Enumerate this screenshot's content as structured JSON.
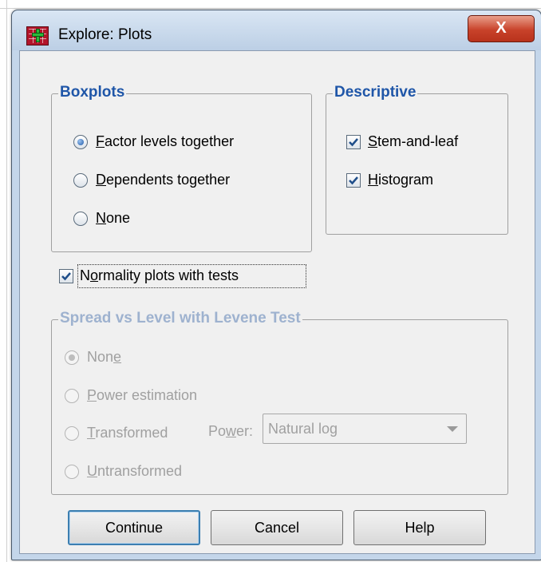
{
  "window": {
    "title": "Explore: Plots",
    "close_glyph": "X",
    "icon": "spss-app-icon"
  },
  "boxplots": {
    "legend": "Boxplots",
    "options": [
      {
        "pre": "",
        "key": "F",
        "post": "actor levels together",
        "selected": true
      },
      {
        "pre": "",
        "key": "D",
        "post": "ependents together",
        "selected": false
      },
      {
        "pre": "",
        "key": "N",
        "post": "one",
        "selected": false
      }
    ]
  },
  "descriptive": {
    "legend": "Descriptive",
    "options": [
      {
        "pre": "",
        "key": "S",
        "post": "tem-and-leaf",
        "checked": true
      },
      {
        "pre": "",
        "key": "H",
        "post": "istogram",
        "checked": true
      }
    ]
  },
  "normality": {
    "pre": "N",
    "key": "o",
    "post": "rmality plots with tests",
    "checked": true
  },
  "spread": {
    "legend": "Spread vs Level with Levene Test",
    "enabled": false,
    "options": [
      {
        "pre": "Non",
        "key": "e",
        "post": "",
        "selected": true
      },
      {
        "pre": "",
        "key": "P",
        "post": "ower estimation",
        "selected": false
      },
      {
        "pre": "",
        "key": "T",
        "post": "ransformed",
        "selected": false
      },
      {
        "pre": "",
        "key": "U",
        "post": "ntransformed",
        "selected": false
      }
    ],
    "power_label": {
      "pre": "Po",
      "key": "w",
      "post": "er:"
    },
    "power_value": "Natural log"
  },
  "buttons": {
    "continue": "Continue",
    "cancel": "Cancel",
    "help": "Help"
  },
  "colors": {
    "legend_blue": "#1f56a8",
    "disabled_text": "#a0a0a0",
    "close_red": "#c8422a",
    "dialog_frame": "#c4d6ea"
  }
}
